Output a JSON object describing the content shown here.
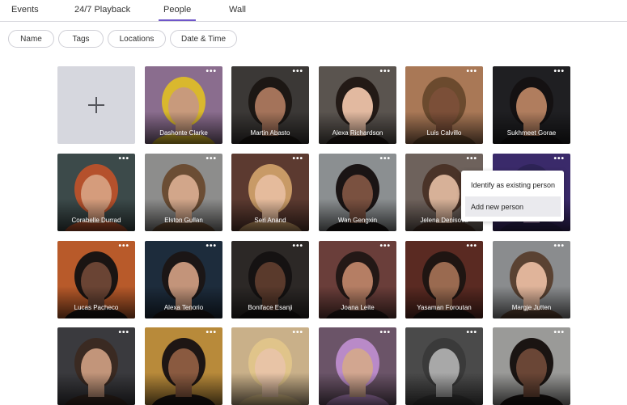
{
  "tabs": [
    {
      "label": "Events",
      "active": false
    },
    {
      "label": "24/7 Playback",
      "active": false
    },
    {
      "label": "People",
      "active": true
    },
    {
      "label": "Wall",
      "active": false
    }
  ],
  "filters": [
    "Name",
    "Tags",
    "Locations",
    "Date & Time"
  ],
  "add_card": {
    "icon": "plus-icon"
  },
  "more_icon": "more-horizontal-icon",
  "people": [
    {
      "name": "Dashonte Clarke",
      "bg": "#8a6d8e",
      "skin": "#c89a7c",
      "hair": "#d9b82e"
    },
    {
      "name": "Martin Abasto",
      "bg": "#3b3836",
      "skin": "#a4735a",
      "hair": "#1c1714"
    },
    {
      "name": "Alexa Richardson",
      "bg": "#5a544f",
      "skin": "#e2b9a0",
      "hair": "#231a16"
    },
    {
      "name": "Luis Calvillo",
      "bg": "#a97856",
      "skin": "#7b4f38",
      "hair": "#6b4a2e"
    },
    {
      "name": "Sukhmeet Gorae",
      "bg": "#1f1f22",
      "skin": "#b07d5e",
      "hair": "#141112"
    },
    {
      "name": "Corabelle Durrad",
      "bg": "#3c4a4a",
      "skin": "#d59c7c",
      "hair": "#b5512c"
    },
    {
      "name": "Elston Gullan",
      "bg": "#8d8d8c",
      "skin": "#d2a68a",
      "hair": "#6b4d34"
    },
    {
      "name": "Seri Anand",
      "bg": "#5c3a30",
      "skin": "#e5bb9c",
      "hair": "#c89a66"
    },
    {
      "name": "Wan Gengxin",
      "bg": "#8b8f91",
      "skin": "#7a5140",
      "hair": "#1a1414"
    },
    {
      "name": "Jelena Denisova",
      "bg": "#6e625c",
      "skin": "#d7b198",
      "hair": "#4a3328"
    },
    {
      "name": "",
      "bg": "#3a2a6a",
      "skin": "#9a7ab0",
      "hair": "#2d2356"
    },
    {
      "name": "Lucas Pacheco",
      "bg": "#b85a2a",
      "skin": "#6a4434",
      "hair": "#1a1412"
    },
    {
      "name": "Alexa Tenorio",
      "bg": "#1d2c3c",
      "skin": "#c3947a",
      "hair": "#1b1616"
    },
    {
      "name": "Boniface Esanji",
      "bg": "#2c2826",
      "skin": "#5a3a2c",
      "hair": "#151212"
    },
    {
      "name": "Joana Leite",
      "bg": "#6a3e3a",
      "skin": "#b57e64",
      "hair": "#231816"
    },
    {
      "name": "Yasaman Foroutan",
      "bg": "#5a2a22",
      "skin": "#9a6a50",
      "hair": "#1f1512"
    },
    {
      "name": "Margje Jutten",
      "bg": "#8a8c8e",
      "skin": "#e0b49a",
      "hair": "#5a4232"
    },
    {
      "name": "",
      "bg": "#3a3a3e",
      "skin": "#c2957a",
      "hair": "#3a2a22"
    },
    {
      "name": "",
      "bg": "#b88a3a",
      "skin": "#8a5a40",
      "hair": "#1e1614"
    },
    {
      "name": "",
      "bg": "#c9b089",
      "skin": "#e8c4a6",
      "hair": "#e0c48a"
    },
    {
      "name": "",
      "bg": "#6b5468",
      "skin": "#d2a690",
      "hair": "#b98ac8"
    },
    {
      "name": "",
      "bg": "#4a4a4a",
      "skin": "#a8a8a8",
      "hair": "#3a3a3a"
    },
    {
      "name": "",
      "bg": "#9a9a98",
      "skin": "#6a4636",
      "hair": "#1a1412"
    }
  ],
  "context_menu": {
    "items": [
      "Identify as existing person",
      "Add new person"
    ],
    "highlighted_index": 1
  },
  "colors": {
    "accent": "#6f56c9",
    "add_card_bg": "#d6d7de"
  }
}
